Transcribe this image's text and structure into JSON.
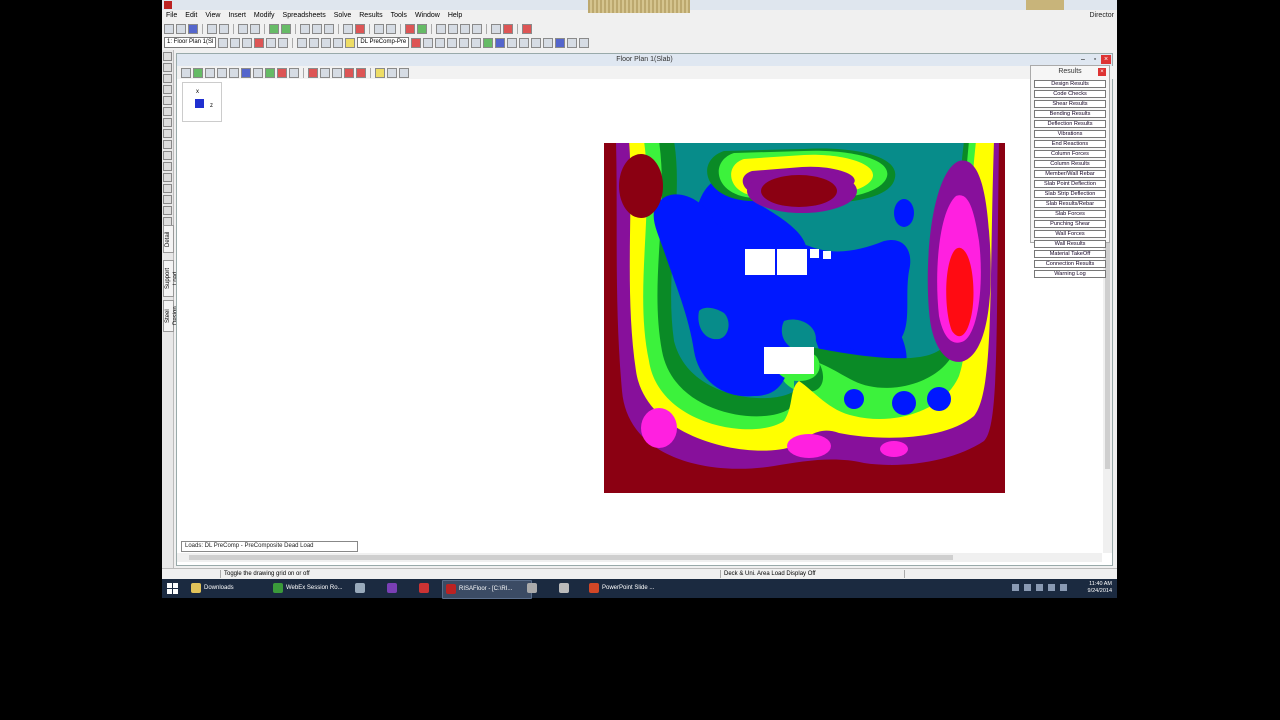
{
  "window": {
    "user": "Director"
  },
  "menu": [
    "File",
    "Edit",
    "View",
    "Insert",
    "Modify",
    "Spreadsheets",
    "Solve",
    "Results",
    "Tools",
    "Window",
    "Help"
  ],
  "toolbar2": {
    "floor_combo": "1: Floor Plan 1(Sl",
    "load_combo": "DL PreComp-Pre"
  },
  "doc": {
    "title": "Floor Plan 1(Slab)"
  },
  "axis": {
    "x": "x",
    "z": "z"
  },
  "loads_box": "Loads: DL PreComp - PreComposite Dead Load",
  "side_tabs": [
    "Detail",
    "Support Load",
    "Steel Design"
  ],
  "results": {
    "title": "Results",
    "close": "×",
    "items": [
      "Design Results",
      "Code Checks",
      "Shear Results",
      "Bending Results",
      "Deflection Results",
      "Vibrations",
      "End Reactions",
      "Column Forces",
      "Column Results",
      "Member/Wall Rebar",
      "Slab Point Deflection",
      "Slab Strip Deflection",
      "Slab Results/Rebar",
      "Slab Forces",
      "Punching Shear",
      "Wall Forces",
      "Wall Results",
      "Material TakeOff",
      "Connection Results",
      "Warning Log"
    ]
  },
  "status": {
    "left": "Toggle the drawing grid on or off",
    "right": "Deck & Uni. Area Load Display Off"
  },
  "taskbar": {
    "tasks": [
      "Downloads",
      "WebEx Session Ro...",
      "RISAFloor - [C:\\RI...",
      "PowerPoint Slide ..."
    ],
    "time": "11:40 AM",
    "date": "9/24/2014"
  },
  "colors": {
    "dark_red": "#8b0012",
    "purple": "#87109b",
    "magenta": "#ff20e0",
    "red": "#ff0b12",
    "yellow": "#ffff00",
    "green": "#3cf23c",
    "dark_green": "#0a8a26",
    "teal": "#078c8a",
    "blue": "#0018ff"
  }
}
